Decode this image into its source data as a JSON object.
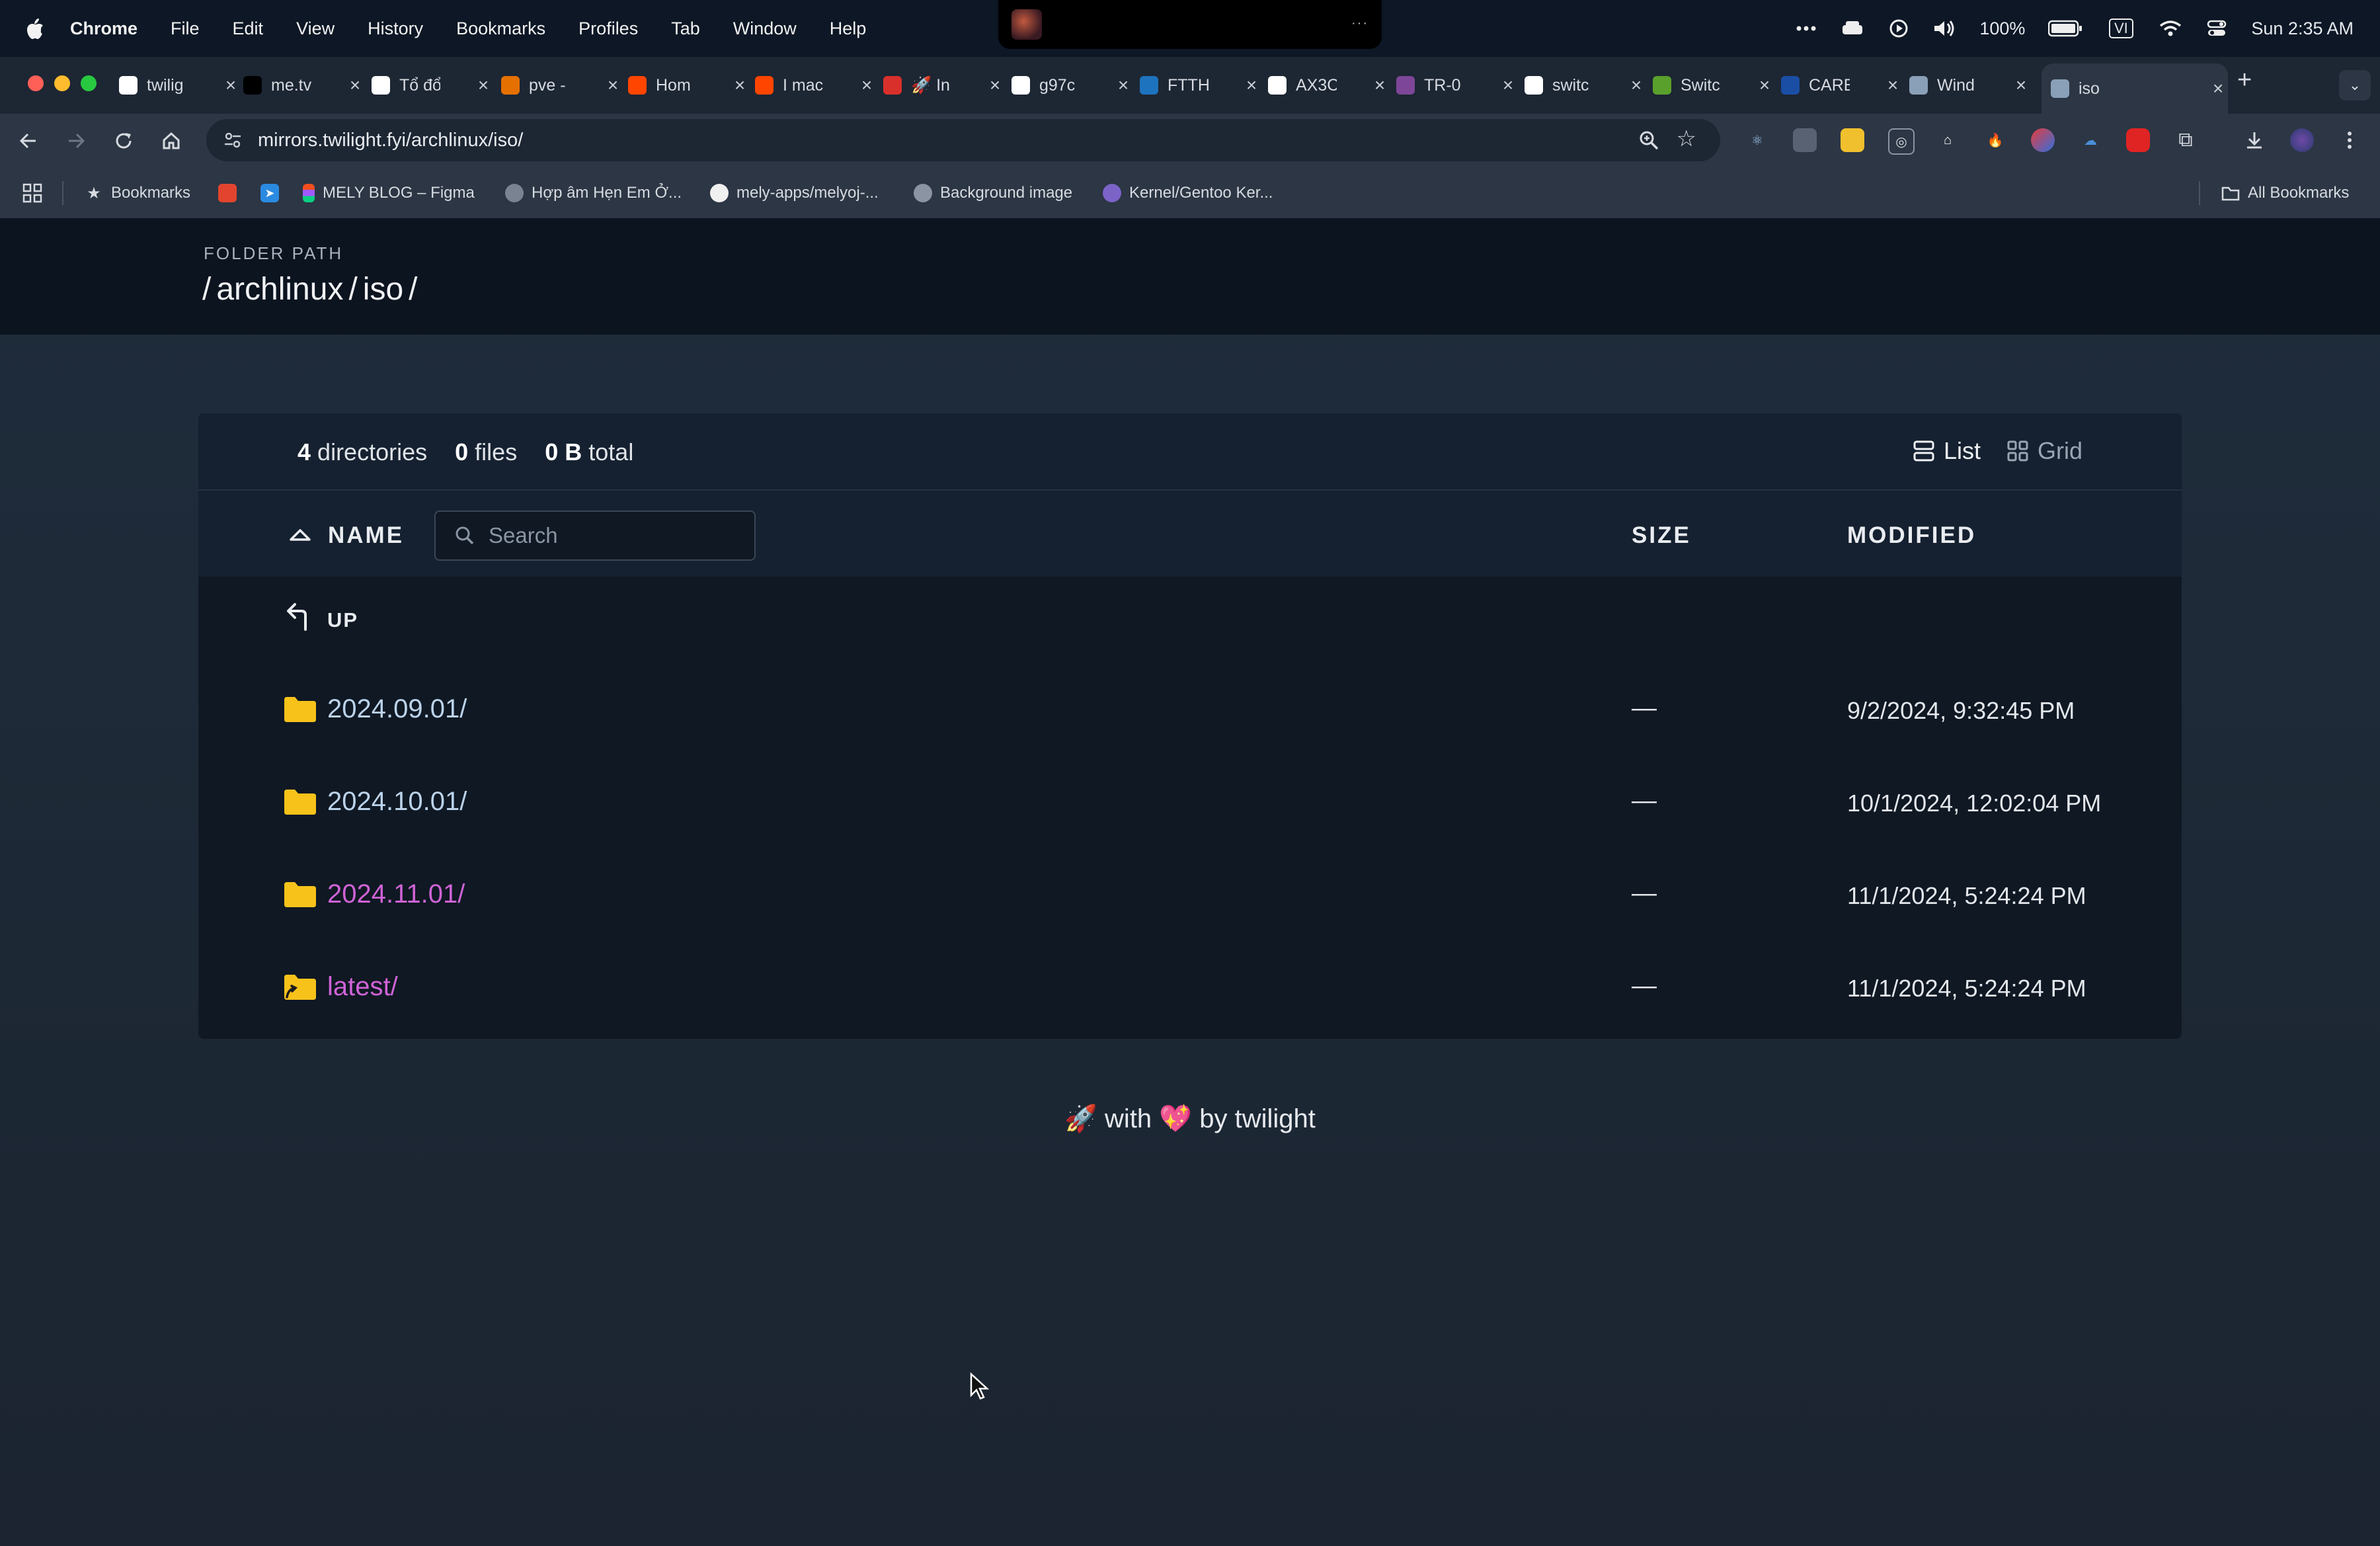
{
  "menubar": {
    "app": "Chrome",
    "items": [
      "File",
      "Edit",
      "View",
      "History",
      "Bookmarks",
      "Profiles",
      "Tab",
      "Window",
      "Help"
    ],
    "battery": "100%",
    "input_source": "VI",
    "clock": "Sun 2:35 AM"
  },
  "tabs": [
    {
      "title": "twilig",
      "icon": "notion-icon",
      "color": "#ffffff"
    },
    {
      "title": "me.tv",
      "icon": "vercel-icon",
      "color": "#000000"
    },
    {
      "title": "Tổ đổ",
      "icon": "notion-icon",
      "color": "#ffffff"
    },
    {
      "title": "pve -",
      "icon": "proxmox-icon",
      "color": "#e57000"
    },
    {
      "title": "Hom",
      "icon": "reddit-icon",
      "color": "#ff4500"
    },
    {
      "title": "I mac",
      "icon": "reddit-icon",
      "color": "#ff4500"
    },
    {
      "title": "🚀 In",
      "icon": "red-logo-icon",
      "color": "#d9302c"
    },
    {
      "title": "g97c",
      "icon": "google-icon",
      "color": "#ffffff"
    },
    {
      "title": "FTTH",
      "icon": "t-icon",
      "color": "#1e73be"
    },
    {
      "title": "AX3C",
      "icon": "google-icon",
      "color": "#ffffff"
    },
    {
      "title": "TR-0",
      "icon": "tor-icon",
      "color": "#7d4698"
    },
    {
      "title": "switc",
      "icon": "google-icon",
      "color": "#ffffff"
    },
    {
      "title": "Switc",
      "icon": "green-logo-icon",
      "color": "#5aa02c"
    },
    {
      "title": "CARE",
      "icon": "asus-icon",
      "color": "#1a4ea5"
    },
    {
      "title": "Wind",
      "icon": "globe-icon",
      "color": "#8aa0b8"
    },
    {
      "title": "iso",
      "icon": "globe-icon",
      "color": "#8aa0b8"
    }
  ],
  "toolbar": {
    "url": "mirrors.twilight.fyi/archlinux/iso/"
  },
  "bookmarks": {
    "items": [
      {
        "label": "Bookmarks",
        "icon": "star-icon"
      },
      {
        "label": "",
        "icon": "shopping-bag-icon"
      },
      {
        "label": "",
        "icon": "telegram-icon"
      },
      {
        "label": "MELY BLOG – Figma",
        "icon": "figma-icon"
      },
      {
        "label": "Hợp âm Hẹn Em Ở...",
        "icon": "music-icon"
      },
      {
        "label": "mely-apps/melyoj-...",
        "icon": "github-icon"
      },
      {
        "label": "Background image",
        "icon": "globe-icon"
      },
      {
        "label": "Kernel/Gentoo Ker...",
        "icon": "gentoo-icon"
      }
    ],
    "all": "All Bookmarks"
  },
  "page": {
    "folder_label": "FOLDER PATH",
    "path": [
      "/",
      "archlinux",
      "/",
      "iso",
      "/"
    ],
    "summary": {
      "dirs": "4",
      "dirs_label": "directories",
      "files": "0",
      "files_label": "files",
      "total": "0 B",
      "total_label": "total"
    },
    "view": {
      "list": "List",
      "grid": "Grid"
    },
    "columns": {
      "name": "NAME",
      "size": "SIZE",
      "modified": "MODIFIED"
    },
    "search_placeholder": "Search",
    "up_label": "UP",
    "rows": [
      {
        "name": "2024.09.01/",
        "size": "—",
        "modified": "9/2/2024, 9:32:45 PM",
        "visited": false,
        "symlink": false
      },
      {
        "name": "2024.10.01/",
        "size": "—",
        "modified": "10/1/2024, 12:02:04 PM",
        "visited": false,
        "symlink": false
      },
      {
        "name": "2024.11.01/",
        "size": "—",
        "modified": "11/1/2024, 5:24:24 PM",
        "visited": true,
        "symlink": false
      },
      {
        "name": "latest/",
        "size": "—",
        "modified": "11/1/2024, 5:24:24 PM",
        "visited": true,
        "symlink": true
      }
    ],
    "footer": {
      "rocket": "🚀",
      "with": "with",
      "heart": "💖",
      "by": "by twilight"
    }
  },
  "colors": {
    "link": "#bcd3ea",
    "visited": "#cf63d6",
    "folder": "#f7c21a"
  }
}
